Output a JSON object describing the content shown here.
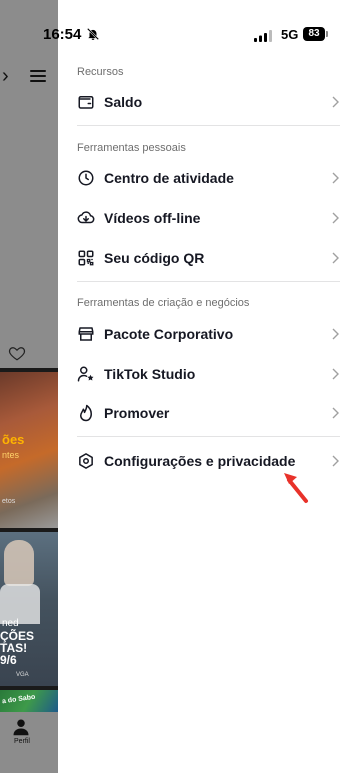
{
  "status_bar": {
    "time": "16:54",
    "network": "5G",
    "battery": "83"
  },
  "background_app": {
    "thumb1_title": "ões",
    "thumb1_sub": "ntes",
    "thumb1_caption": "etos",
    "thumb2_line1": "ned",
    "thumb2_line2": "ÇÕES",
    "thumb2_line3": "TAS!",
    "thumb2_line4": "9/6",
    "thumb2_small": "VGA",
    "thumb3_text": "a do Sabo",
    "nav_profile_label": "Perfil"
  },
  "drawer": {
    "sections": [
      {
        "header": "Recursos",
        "items": [
          {
            "label": "Saldo",
            "icon": "wallet-icon"
          }
        ]
      },
      {
        "header": "Ferramentas pessoais",
        "items": [
          {
            "label": "Centro de atividade",
            "icon": "clock-icon"
          },
          {
            "label": "Vídeos off-line",
            "icon": "download-cloud-icon"
          },
          {
            "label": "Seu código QR",
            "icon": "qr-code-icon"
          }
        ]
      },
      {
        "header": "Ferramentas de criação e negócios",
        "items": [
          {
            "label": "Pacote Corporativo",
            "icon": "store-icon"
          },
          {
            "label": "TikTok Studio",
            "icon": "person-star-icon"
          },
          {
            "label": "Promover",
            "icon": "flame-icon"
          }
        ]
      },
      {
        "header": "",
        "items": [
          {
            "label": "Configurações e privacidade",
            "icon": "settings-icon"
          }
        ]
      }
    ]
  },
  "colors": {
    "annotation_arrow": "#e8322a",
    "text_primary": "#161823",
    "section_header": "#6e6e6e"
  }
}
